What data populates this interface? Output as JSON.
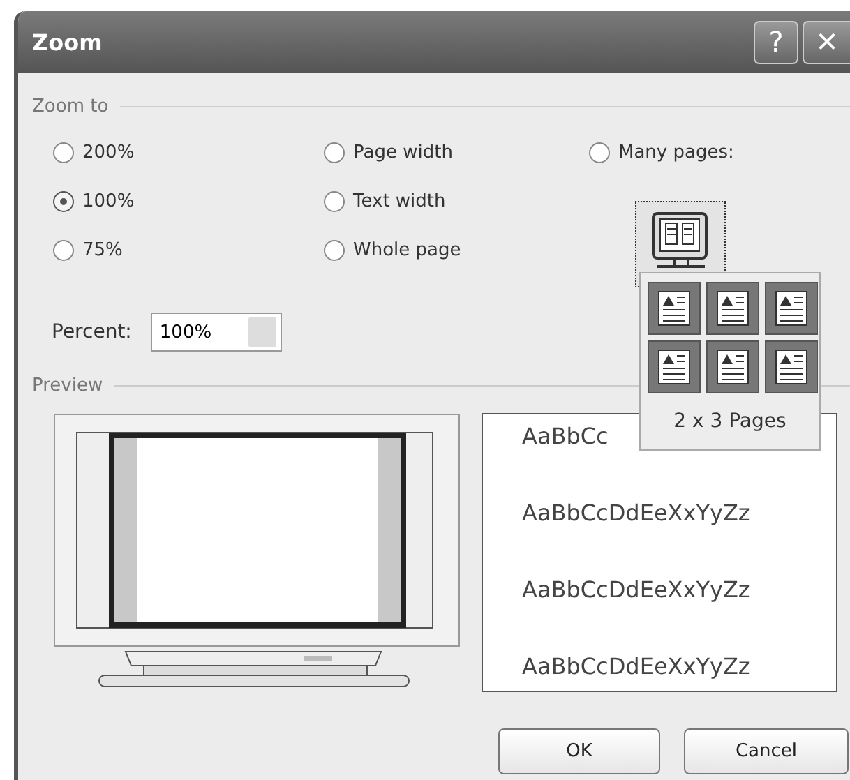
{
  "window": {
    "title": "Zoom",
    "title_buttons": [
      {
        "kind": "help",
        "glyph": "?"
      },
      {
        "kind": "close",
        "glyph": "✕"
      }
    ]
  },
  "zoom_to": {
    "label": "Zoom to",
    "columns": [
      [
        {
          "label": "200%",
          "selected": false
        },
        {
          "label": "100%",
          "selected": true
        },
        {
          "label": "75%",
          "selected": false
        }
      ],
      [
        {
          "label": "Page width",
          "selected": false
        },
        {
          "label": "Text width",
          "selected": false
        },
        {
          "label": "Whole page",
          "selected": false
        }
      ],
      [
        {
          "label": "Many pages:",
          "selected": false
        }
      ]
    ],
    "percent": {
      "label": "Percent:",
      "value": "100%"
    }
  },
  "many_pages_picker": {
    "cells": [
      {
        "selected": true
      },
      {
        "selected": true
      },
      {
        "selected": true
      },
      {
        "selected": true
      },
      {
        "selected": true
      },
      {
        "selected": true
      }
    ],
    "caption": "2 x 3 Pages"
  },
  "preview": {
    "label": "Preview",
    "sample_lines": [
      "AaBbCc",
      "AaBbCcDdEeXxYyZz",
      "AaBbCcDdEeXxYyZz",
      "AaBbCcDdEeXxYyZz"
    ]
  },
  "buttons": [
    "OK",
    "Cancel"
  ]
}
